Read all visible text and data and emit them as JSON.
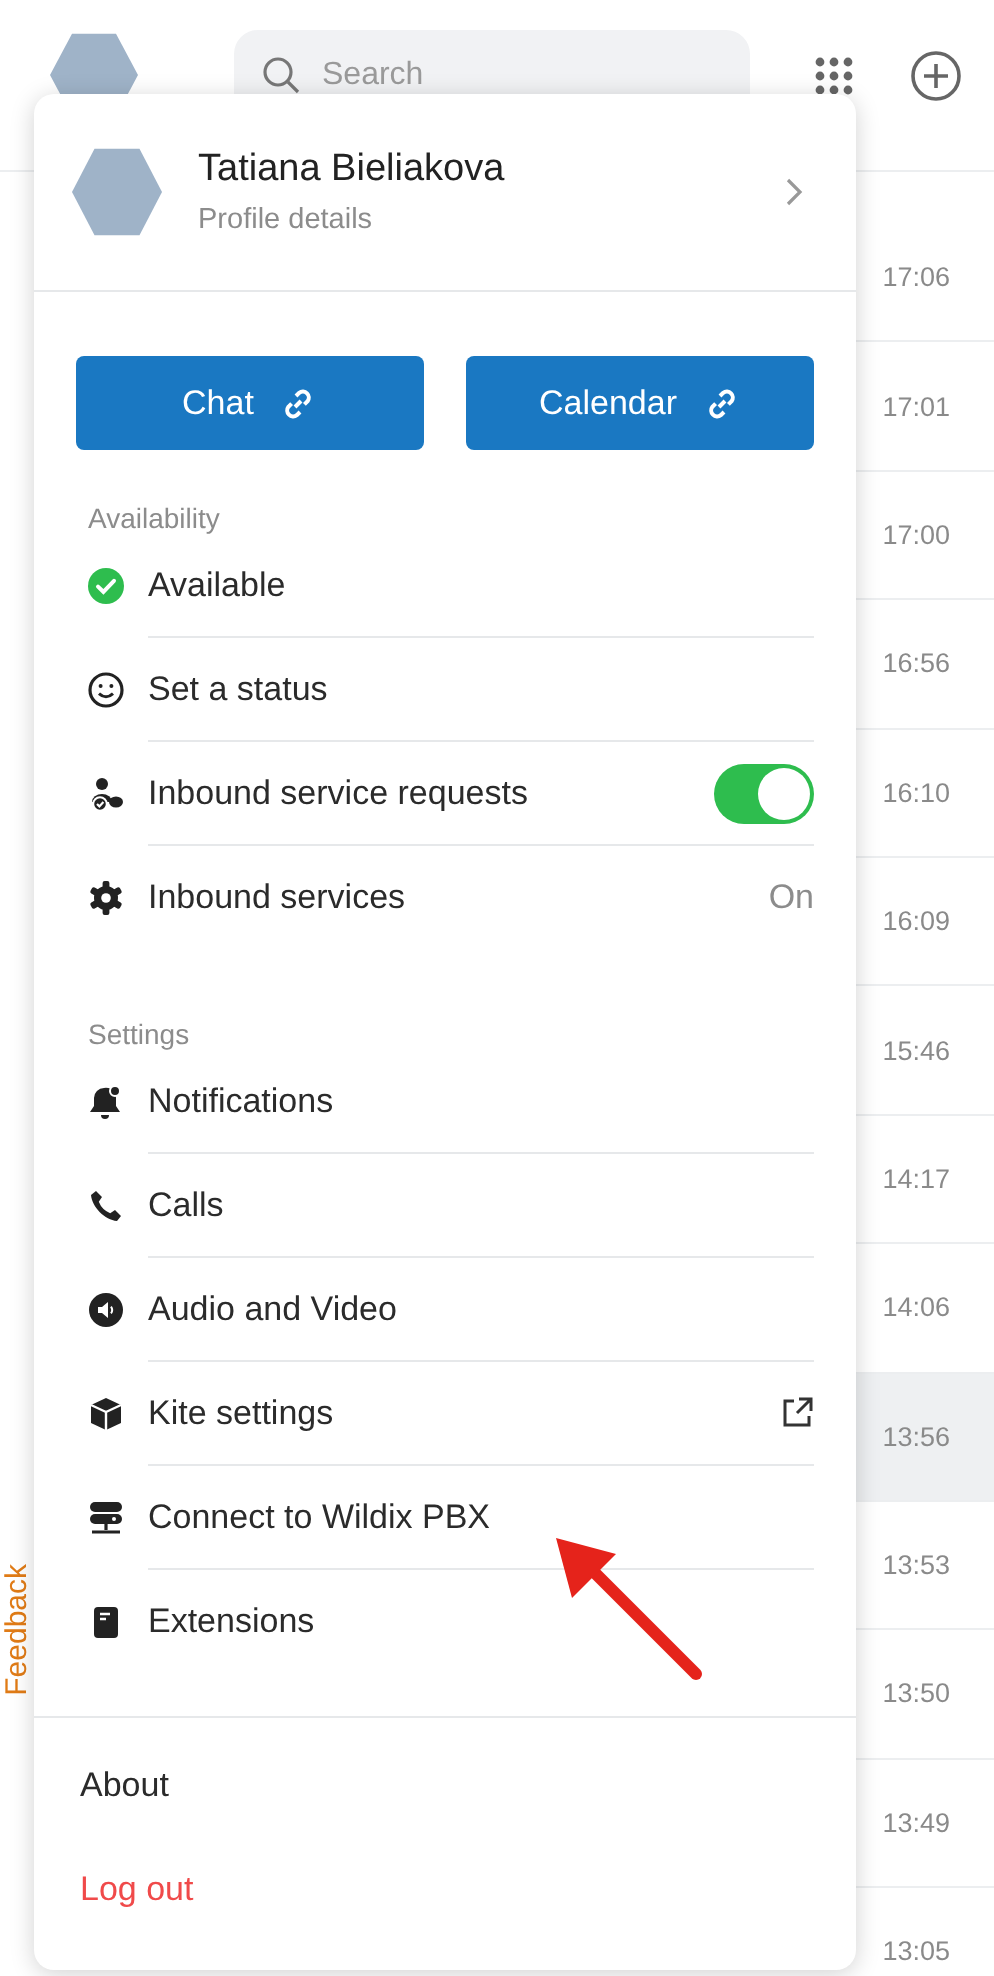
{
  "top_bar": {
    "search": {
      "placeholder": "Search"
    }
  },
  "feedback_tab": {
    "label": "Feedback"
  },
  "chat_list": {
    "rows": [
      {
        "time": "17:06",
        "selected": false
      },
      {
        "time": "17:01",
        "selected": false
      },
      {
        "time": "17:00",
        "selected": false
      },
      {
        "time": "16:56",
        "selected": false
      },
      {
        "time": "16:10",
        "selected": false
      },
      {
        "time": "16:09",
        "selected": false
      },
      {
        "time": "15:46",
        "selected": false
      },
      {
        "time": "14:17",
        "selected": false
      },
      {
        "time": "14:06",
        "selected": false
      },
      {
        "time": "13:56",
        "selected": true
      },
      {
        "time": "13:53",
        "selected": false
      },
      {
        "time": "13:50",
        "selected": false
      },
      {
        "time": "13:49",
        "selected": false
      },
      {
        "time": "13:05",
        "selected": false
      }
    ]
  },
  "profile_menu": {
    "name": "Tatiana Bieliakova",
    "subtitle": "Profile details",
    "buttons": [
      {
        "label": "Chat"
      },
      {
        "label": "Calendar"
      }
    ],
    "sections": [
      {
        "title": "Availability",
        "items": [
          {
            "kind": "link",
            "label": "Available"
          },
          {
            "kind": "link",
            "label": "Set a status"
          },
          {
            "kind": "toggle",
            "label": "Inbound service requests",
            "on": true
          },
          {
            "kind": "value",
            "label": "Inbound services",
            "value": "On"
          }
        ]
      },
      {
        "title": "Settings",
        "items": [
          {
            "kind": "link",
            "label": "Notifications"
          },
          {
            "kind": "link",
            "label": "Calls"
          },
          {
            "kind": "link",
            "label": "Audio and Video"
          },
          {
            "kind": "external",
            "label": "Kite settings"
          },
          {
            "kind": "link",
            "label": "Connect to Wildix PBX"
          },
          {
            "kind": "link",
            "label": "Extensions"
          }
        ]
      }
    ],
    "footer": [
      {
        "kind": "plain",
        "label": "About"
      },
      {
        "kind": "danger",
        "label": "Log out"
      }
    ]
  }
}
